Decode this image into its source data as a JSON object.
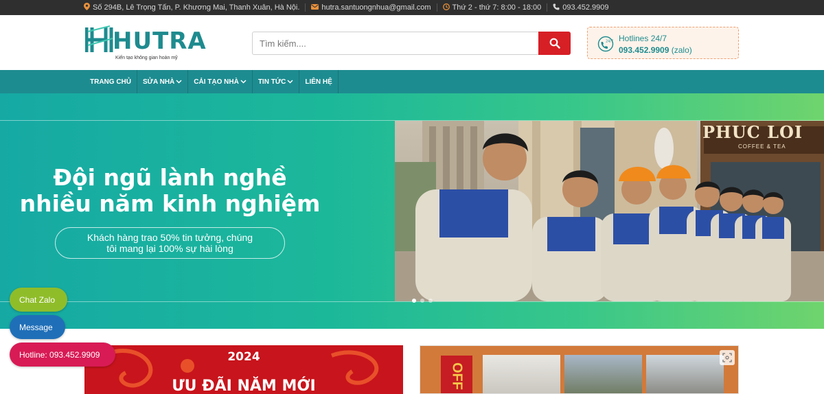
{
  "topbar": {
    "address": "Số 294B, Lê Trọng Tấn, P. Khương Mai, Thanh Xuân, Hà Nội.",
    "email": "hutra.santuongnhua@gmail.com",
    "hours": "Thứ 2 - thứ 7: 8:00 - 18:00",
    "phone": "093.452.9909"
  },
  "header": {
    "logo_text": "HUTRA",
    "logo_tagline": "Kiến tạo không gian hoàn mỹ",
    "search_placeholder": "Tìm kiếm....",
    "hotline_title": "Hotlines 24/7",
    "hotline_number": "093.452.9909",
    "hotline_suffix": "(zalo)"
  },
  "nav": {
    "items": [
      {
        "label": "TRANG CHỦ",
        "dropdown": false
      },
      {
        "label": "SỬA NHÀ",
        "dropdown": true
      },
      {
        "label": "CẢI TẠO NHÀ",
        "dropdown": true
      },
      {
        "label": "TIN TỨC",
        "dropdown": true
      },
      {
        "label": "LIÊN HỆ",
        "dropdown": false
      }
    ]
  },
  "banner": {
    "headline_1": "Đội ngũ lành nghề",
    "headline_2": "nhiều năm kinh nghiệm",
    "pill_1": "Khách hàng trao 50% tin tưởng, chúng",
    "pill_2": "tôi mang lại 100% sự hài lòng",
    "photo_sign": "PHUC LOI",
    "photo_sign_sub": "COFFEE & TEA",
    "slides": 3,
    "active_slide": 1
  },
  "promos": {
    "left_year": "2024",
    "left_title": "ƯU ĐÃI NĂM MỚI",
    "right_badge": "OFF"
  },
  "floating": {
    "zalo": "Chat Zalo",
    "message": "Message",
    "hotline": "Hotline: 093.452.9909"
  },
  "colors": {
    "brand_teal": "#1d8c90",
    "search_red": "#d71f26",
    "zalo_green": "#8fbd2a",
    "message_blue": "#1f6fb8",
    "hotline_pink": "#d81b55"
  }
}
